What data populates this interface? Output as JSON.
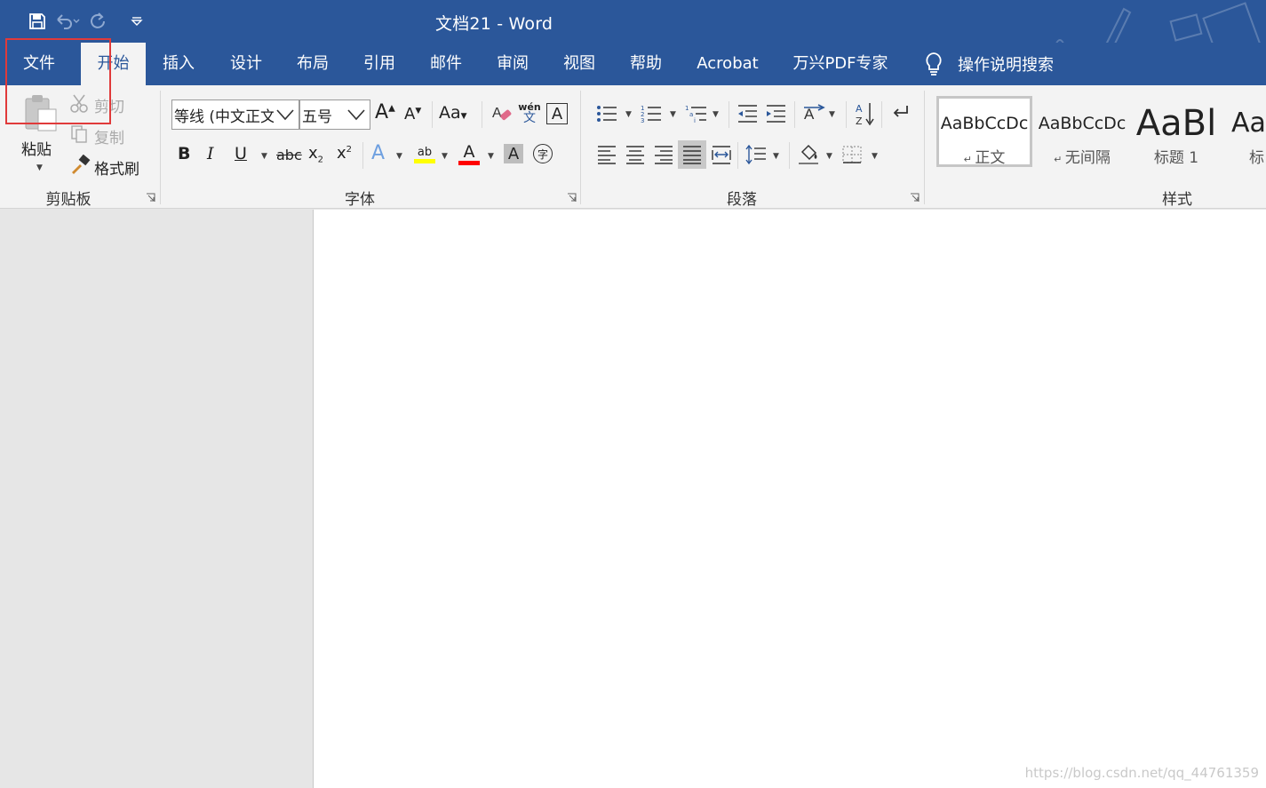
{
  "window": {
    "doc_name": "文档21",
    "separator": " - ",
    "app_name": "Word"
  },
  "qat": {
    "save_icon": "save-icon",
    "undo_icon": "undo-icon",
    "redo_icon": "redo-icon",
    "customize_icon": "customize-qat-icon"
  },
  "tabs": [
    {
      "label": "文件"
    },
    {
      "label": "开始",
      "active": true
    },
    {
      "label": "插入"
    },
    {
      "label": "设计"
    },
    {
      "label": "布局"
    },
    {
      "label": "引用"
    },
    {
      "label": "邮件"
    },
    {
      "label": "审阅"
    },
    {
      "label": "视图"
    },
    {
      "label": "帮助"
    },
    {
      "label": "Acrobat"
    },
    {
      "label": "万兴PDF专家"
    }
  ],
  "tell_me": "操作说明搜索",
  "clipboard": {
    "paste": "粘贴",
    "cut": "剪切",
    "copy": "复制",
    "format_painter": "格式刷",
    "group_label": "剪贴板"
  },
  "font": {
    "font_name": "等线 (中文正文",
    "font_size": "五号",
    "grow": "A",
    "shrink": "A",
    "change_case": "Aa",
    "phonetic_top": "wén",
    "phonetic_bottom": "文",
    "bold": "B",
    "italic": "I",
    "underline": "U",
    "strike": "abc",
    "subscript": "x",
    "superscript": "x",
    "highlight_label": "ab",
    "font_color_label": "A",
    "shading_label": "A",
    "enclose_label": "字",
    "group_label": "字体",
    "highlight_color": "#ffff00",
    "font_color": "#ff0000"
  },
  "paragraph": {
    "group_label": "段落"
  },
  "styles": {
    "items": [
      {
        "sample": "AaBbCcDc",
        "name": "正文"
      },
      {
        "sample": "AaBbCcDc",
        "name": "无间隔"
      },
      {
        "sample": "AaBl",
        "name": "标题 1"
      },
      {
        "sample": "Aa",
        "name": "标"
      }
    ],
    "group_label": "样式"
  },
  "watermark": "https://blog.csdn.net/qq_44761359",
  "colors": {
    "accent": "#2b579a",
    "ribbon_bg": "#f3f3f3",
    "highlight_frame": "#e03a3a"
  }
}
